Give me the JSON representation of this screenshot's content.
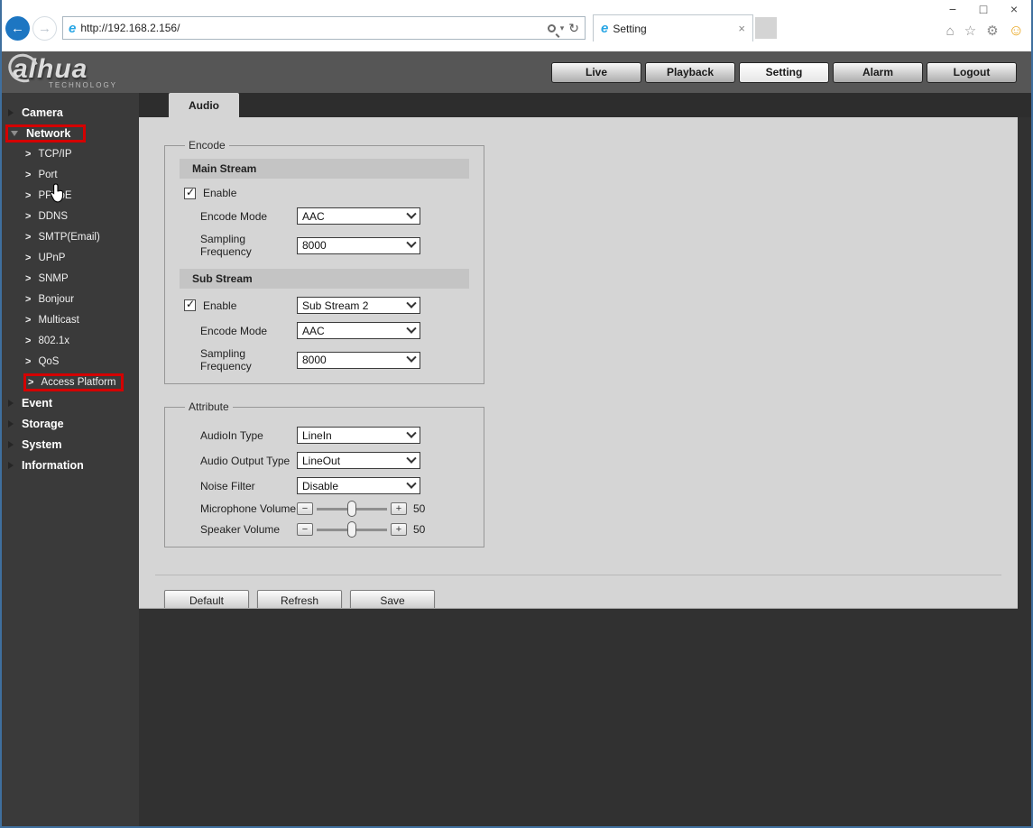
{
  "browser": {
    "url": "http://192.168.2.156/",
    "tab_title": "Setting"
  },
  "icons": {
    "back": "←",
    "forward": "→",
    "search_caret": "▾",
    "refresh": "↻",
    "tab_close": "×",
    "minimize": "−",
    "maximize": "□",
    "close": "×",
    "home": "⌂",
    "favorites": "☆",
    "tools": "⚙",
    "smiley": "☺",
    "sub_bullet": ">",
    "check": "✓",
    "minus": "−",
    "plus": "+"
  },
  "header": {
    "logo_text": "alhua",
    "logo_sub": "TECHNOLOGY",
    "nav": [
      {
        "label": "Live"
      },
      {
        "label": "Playback"
      },
      {
        "label": "Setting"
      },
      {
        "label": "Alarm"
      },
      {
        "label": "Logout"
      }
    ]
  },
  "sidebar": {
    "items": [
      {
        "label": "Camera"
      },
      {
        "label": "Network"
      },
      {
        "label": "TCP/IP"
      },
      {
        "label": "Port"
      },
      {
        "label": "PPPoE"
      },
      {
        "label": "DDNS"
      },
      {
        "label": "SMTP(Email)"
      },
      {
        "label": "UPnP"
      },
      {
        "label": "SNMP"
      },
      {
        "label": "Bonjour"
      },
      {
        "label": "Multicast"
      },
      {
        "label": "802.1x"
      },
      {
        "label": "QoS"
      },
      {
        "label": "Access Platform"
      },
      {
        "label": "Event"
      },
      {
        "label": "Storage"
      },
      {
        "label": "System"
      },
      {
        "label": "Information"
      }
    ]
  },
  "main": {
    "tab_label": "Audio",
    "encode": {
      "legend": "Encode",
      "main_stream": {
        "title": "Main Stream",
        "enable_label": "Enable",
        "encode_mode_label": "Encode Mode",
        "encode_mode_value": "AAC",
        "sampling_label": "Sampling Frequency",
        "sampling_value": "8000"
      },
      "sub_stream": {
        "title": "Sub Stream",
        "enable_label": "Enable",
        "stream_value": "Sub Stream 2",
        "encode_mode_label": "Encode Mode",
        "encode_mode_value": "AAC",
        "sampling_label": "Sampling Frequency",
        "sampling_value": "8000"
      }
    },
    "attribute": {
      "legend": "Attribute",
      "audioin_label": "AudioIn Type",
      "audioin_value": "LineIn",
      "output_label": "Audio Output Type",
      "output_value": "LineOut",
      "noise_label": "Noise Filter",
      "noise_value": "Disable",
      "mic_label": "Microphone Volume",
      "mic_value": "50",
      "speaker_label": "Speaker Volume",
      "speaker_value": "50"
    },
    "actions": {
      "default_label": "Default",
      "refresh_label": "Refresh",
      "save_label": "Save"
    }
  }
}
